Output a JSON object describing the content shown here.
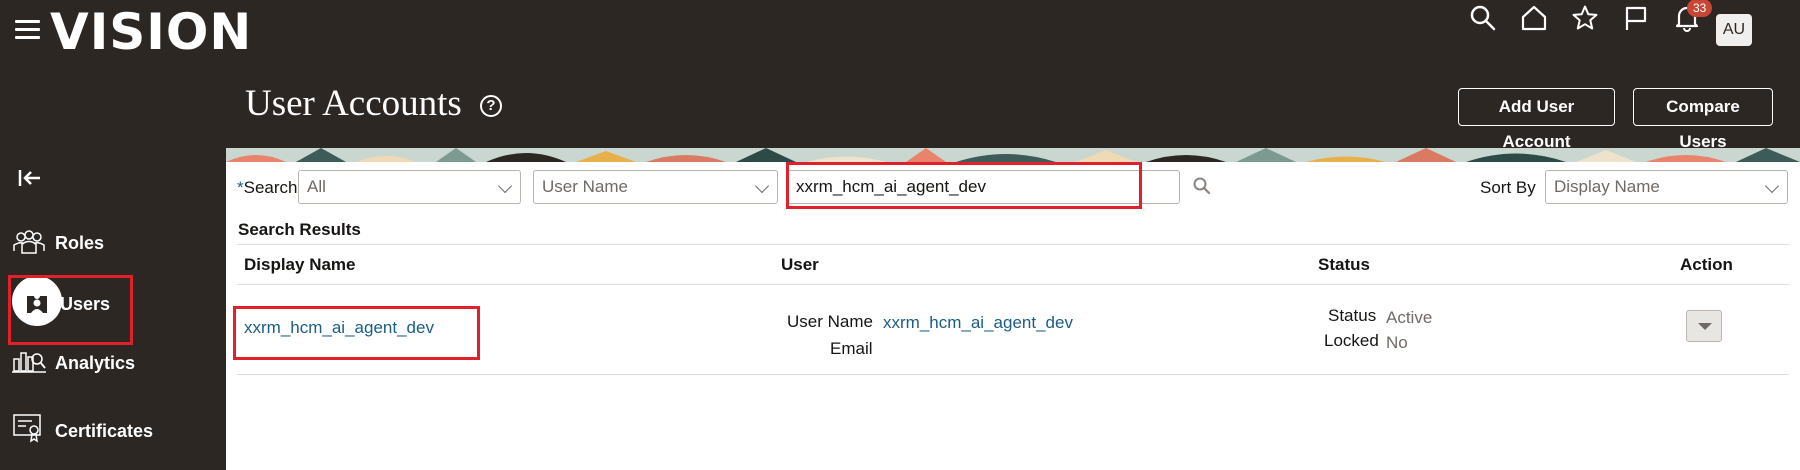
{
  "header": {
    "logo": "VISION",
    "notifications_count": "33",
    "avatar_initials": "AU"
  },
  "page": {
    "title": "User Accounts",
    "add_button": "Add User Account",
    "compare_button": "Compare Users"
  },
  "sidebar": {
    "items": [
      {
        "label": "Roles",
        "icon": "roles-icon"
      },
      {
        "label": "Users",
        "icon": "user-icon",
        "active": true
      },
      {
        "label": "Analytics",
        "icon": "analytics-icon"
      },
      {
        "label": "Certificates",
        "icon": "certificate-icon"
      }
    ]
  },
  "search": {
    "label": "Search",
    "scope_value": "All",
    "field_value": "User Name",
    "query": "xxrm_hcm_ai_agent_dev",
    "sort_label": "Sort By",
    "sort_value": "Display Name"
  },
  "results": {
    "title": "Search Results",
    "columns": [
      "Display Name",
      "User",
      "Status",
      "Action"
    ],
    "rows": [
      {
        "display_name": "xxrm_hcm_ai_agent_dev",
        "user_name_label": "User Name",
        "user_name": "xxrm_hcm_ai_agent_dev",
        "email_label": "Email",
        "status_label": "Status",
        "status": "Active",
        "locked_label": "Locked",
        "locked": "No"
      }
    ]
  },
  "colors": {
    "header_bg": "#2d2724",
    "link": "#1a5e85",
    "highlight": "#e0202a",
    "badge": "#c74634"
  }
}
